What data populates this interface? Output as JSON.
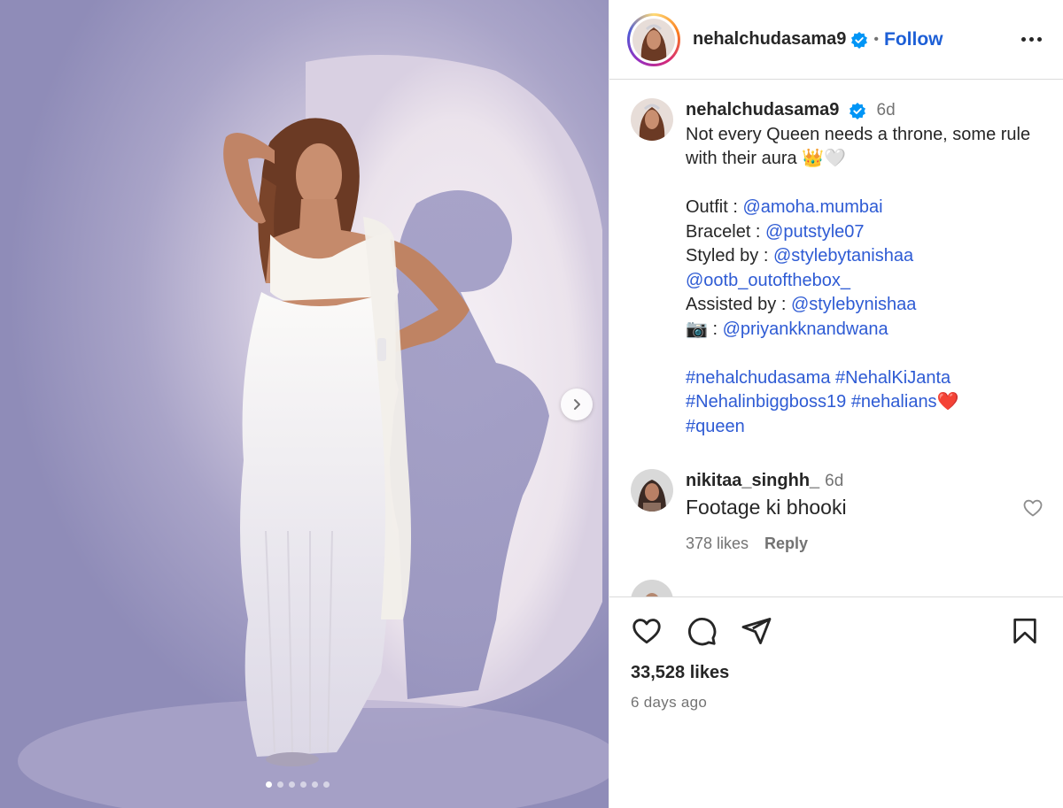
{
  "post": {
    "username": "nehalchudasama9",
    "follow_label": "Follow",
    "separator": "•",
    "likes": "33,528 likes",
    "posted_ago": "6 days ago",
    "carousel_count": 6,
    "carousel_active": 0
  },
  "caption": {
    "username": "nehalchudasama9",
    "time": "6d",
    "line1": "Not every Queen needs a throne, some rule with their aura 👑🤍",
    "outfit_label": "Outfit : ",
    "outfit_handle": "@amoha.mumbai",
    "bracelet_label": "Bracelet : ",
    "bracelet_handle": "@putstyle07",
    "styled_label": "Styled by : ",
    "styled_handle1": "@stylebytanishaa",
    "styled_handle2": "@ootb_outofthebox_",
    "assisted_label": "Assisted by : ",
    "assisted_handle": "@stylebynishaa",
    "camera_label": "📷 : ",
    "camera_handle": "@priyankknandwana",
    "hashtag1": "#nehalchudasama",
    "hashtag2": "#NehalKiJanta",
    "hashtag3": "#Nehalinbiggboss19",
    "hashtag4": "#nehalians",
    "hashtag4_emoji": "❤️",
    "hashtag5": "#queen"
  },
  "comments": [
    {
      "username": "nikitaa_singhh_",
      "time": "6d",
      "text": "Footage ki bhooki",
      "likes": "378 likes",
      "reply_label": "Reply"
    }
  ],
  "colors": {
    "link": "#2e5bd4",
    "follow": "#1d5fd6",
    "verified": "#0095f6",
    "muted": "#737373"
  },
  "icons": [
    "more-icon",
    "verified-icon",
    "heart-icon",
    "comment-icon",
    "share-icon",
    "bookmark-icon",
    "chevron-right-icon"
  ]
}
